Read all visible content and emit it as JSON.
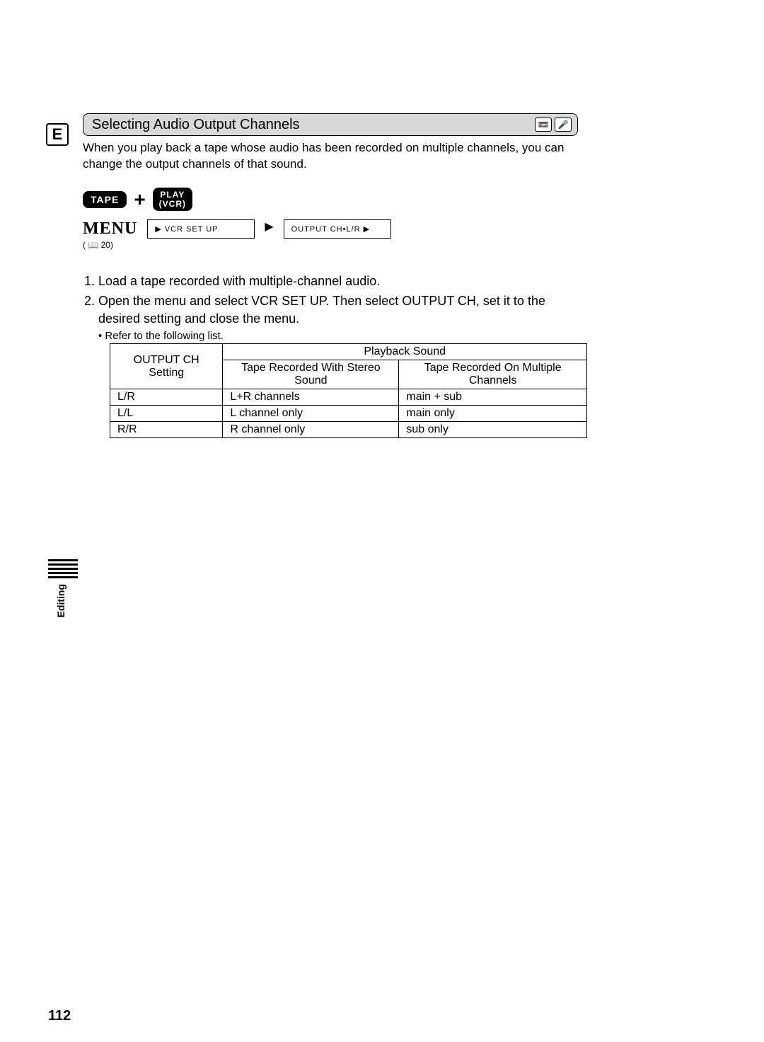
{
  "lang_badge": "E",
  "section_title": "Selecting Audio Output Channels",
  "title_icons": [
    "📼",
    "🎤"
  ],
  "intro": "When you play back a tape whose audio has been recorded on multiple channels, you can change the output channels of that sound.",
  "mode": {
    "tape": "TAPE",
    "plus": "+",
    "play_line1": "PLAY",
    "play_line2": "(VCR)"
  },
  "menu": {
    "word": "MENU",
    "ref": "( 📖 20)",
    "box1_arrow": "▶",
    "box1": "VCR SET UP",
    "sep": "▶",
    "box2": "OUTPUT CH•L/R",
    "box2_arrow": "▶"
  },
  "steps": {
    "s1": "Load a tape recorded with multiple-channel audio.",
    "s2": "Open the menu and select VCR SET UP. Then select OUTPUT CH, set it to the desired setting and close the menu.",
    "s2_sub": "• Refer to the following list."
  },
  "table": {
    "col1_header": "OUTPUT CH Setting",
    "col_span_header": "Playback Sound",
    "col2_header": "Tape Recorded With Stereo Sound",
    "col3_header": "Tape Recorded On Multiple Channels",
    "rows": [
      {
        "c1": "L/R",
        "c2": "L+R channels",
        "c3": "main + sub"
      },
      {
        "c1": "L/L",
        "c2": "L channel only",
        "c3": "main only"
      },
      {
        "c1": "R/R",
        "c2": "R channel only",
        "c3": "sub only"
      }
    ]
  },
  "sidetab": "Editing",
  "page_number": "112"
}
